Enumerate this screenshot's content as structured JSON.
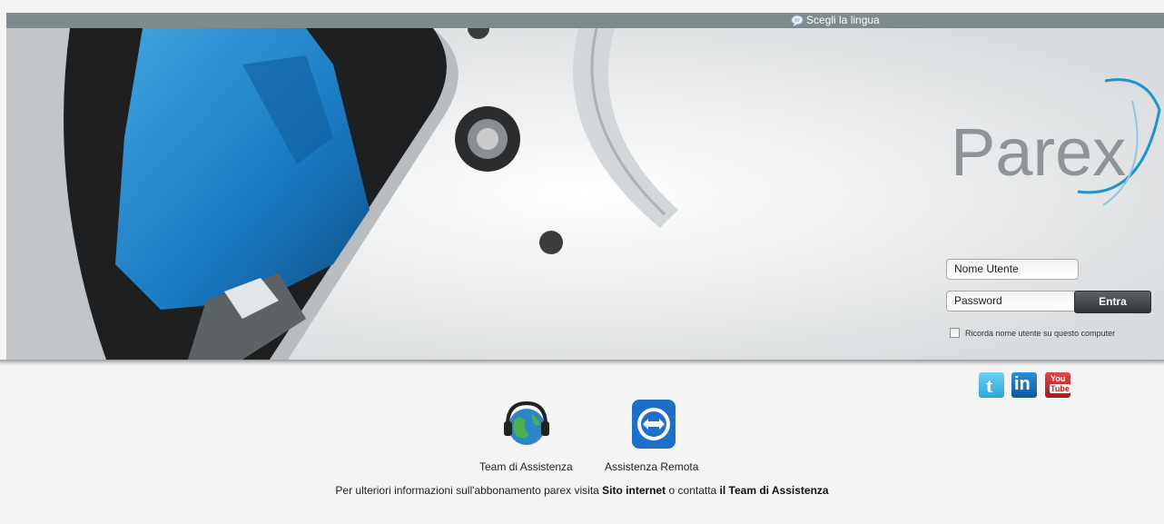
{
  "header": {
    "language_label": "Scegli la lingua"
  },
  "brand": {
    "logo_text": "Parex",
    "accent": "#1f96c9"
  },
  "login": {
    "username_placeholder": "Nome Utente",
    "password_placeholder": "Password",
    "submit_label": "Entra",
    "remember_label": "Ricorda nome utente su questo computer"
  },
  "social": {
    "twitter": "twitter-icon",
    "linkedin": "linkedin-icon",
    "youtube": "youtube-icon",
    "youtube_text_top": "You",
    "youtube_text_bottom": "Tube"
  },
  "support": {
    "team_label": "Team di Assistenza",
    "remote_label": "Assistenza Remota",
    "info_prefix": "Per ulteriori informazioni sull'abbonamento parex visita ",
    "info_site": "Sito internet",
    "info_middle": " o contatta ",
    "info_team": "il Team di Assistenza"
  }
}
